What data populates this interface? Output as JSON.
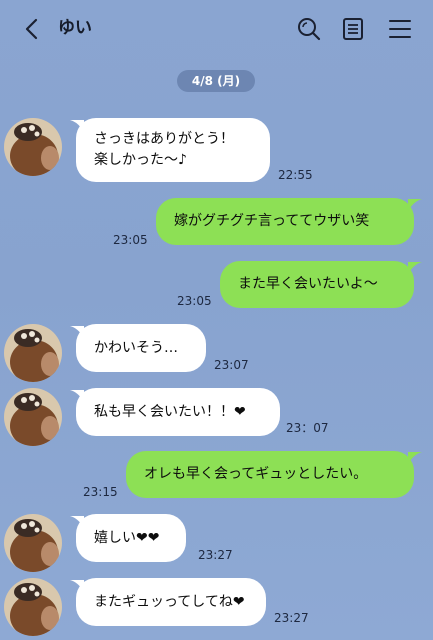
{
  "header": {
    "title": "ゆい",
    "icons": [
      "back-chevron-icon",
      "search-icon",
      "notes-icon",
      "menu-icon"
    ]
  },
  "date_label": "4/8 (月)",
  "messages": [
    {
      "side": "in",
      "text": "さっきはありがとう！\n楽しかった〜♪",
      "time": "22:55"
    },
    {
      "side": "out",
      "text": "嫁がグチグチ言っててウザい笑",
      "time": "23:05"
    },
    {
      "side": "out",
      "text": "また早く会いたいよ〜",
      "time": "23:05"
    },
    {
      "side": "in",
      "text": "かわいそう…",
      "time": "23:07"
    },
    {
      "side": "in",
      "text": "私も早く会いたい！！❤",
      "time": "23：07"
    },
    {
      "side": "out",
      "text": "オレも早く会ってギュッとしたい。",
      "time": "23:15"
    },
    {
      "side": "in",
      "text": "嬉しい❤❤",
      "time": "23:27"
    },
    {
      "side": "in",
      "text": "またギュッってしてね❤",
      "time": "23:27"
    }
  ],
  "colors": {
    "background": "#8aa5d1",
    "incoming_bubble": "#ffffff",
    "outgoing_bubble": "#8de055",
    "date_chip": "#6d86b2"
  }
}
